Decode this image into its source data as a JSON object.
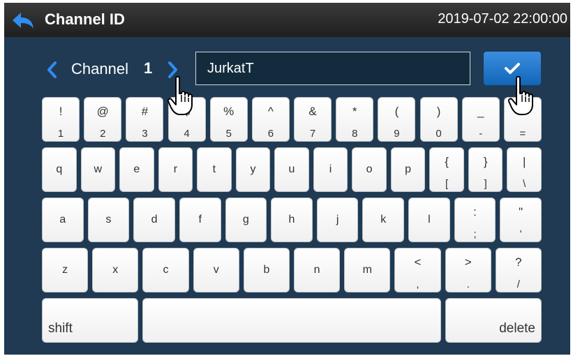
{
  "header": {
    "title": "Channel ID",
    "datetime": "2019-07-02  22:00:00",
    "back_icon": "back-arrow-icon"
  },
  "channel": {
    "label": "Channel",
    "number": "1",
    "prev_icon": "chevron-left-icon",
    "next_icon": "chevron-right-icon"
  },
  "name_input": {
    "value": "JurkatT"
  },
  "confirm_icon": "checkmark-icon",
  "keyboard": {
    "row1": [
      {
        "upper": "!",
        "lower": "1"
      },
      {
        "upper": "@",
        "lower": "2"
      },
      {
        "upper": "#",
        "lower": "3"
      },
      {
        "upper": "$",
        "lower": "4"
      },
      {
        "upper": "%",
        "lower": "5"
      },
      {
        "upper": "^",
        "lower": "6"
      },
      {
        "upper": "&",
        "lower": "7"
      },
      {
        "upper": "*",
        "lower": "8"
      },
      {
        "upper": "(",
        "lower": "9"
      },
      {
        "upper": ")",
        "lower": "0"
      },
      {
        "upper": "_",
        "lower": "-"
      },
      {
        "upper": "+",
        "lower": "="
      }
    ],
    "row2": [
      {
        "lower": "q"
      },
      {
        "lower": "w"
      },
      {
        "lower": "e"
      },
      {
        "lower": "r"
      },
      {
        "lower": "t"
      },
      {
        "lower": "y"
      },
      {
        "lower": "u"
      },
      {
        "lower": "i"
      },
      {
        "lower": "o"
      },
      {
        "lower": "p"
      },
      {
        "upper": "{",
        "lower": "["
      },
      {
        "upper": "}",
        "lower": "]"
      },
      {
        "upper": "|",
        "lower": "\\"
      }
    ],
    "row3": [
      {
        "lower": "a"
      },
      {
        "lower": "s"
      },
      {
        "lower": "d"
      },
      {
        "lower": "f"
      },
      {
        "lower": "g"
      },
      {
        "lower": "h"
      },
      {
        "lower": "j"
      },
      {
        "lower": "k"
      },
      {
        "lower": "l"
      },
      {
        "upper": ":",
        "lower": ";"
      },
      {
        "upper": "\"",
        "lower": "'"
      }
    ],
    "row4": [
      {
        "lower": "z"
      },
      {
        "lower": "x"
      },
      {
        "lower": "c"
      },
      {
        "lower": "v"
      },
      {
        "lower": "b"
      },
      {
        "lower": "n"
      },
      {
        "lower": "m"
      },
      {
        "upper": "<",
        "lower": ","
      },
      {
        "upper": ">",
        "lower": "."
      },
      {
        "upper": "?",
        "lower": "/"
      }
    ],
    "shift_label": "shift",
    "delete_label": "delete"
  },
  "colors": {
    "background": "#1f3a52",
    "accent": "#1a7be0",
    "title_bar": "#2b2b2b"
  }
}
